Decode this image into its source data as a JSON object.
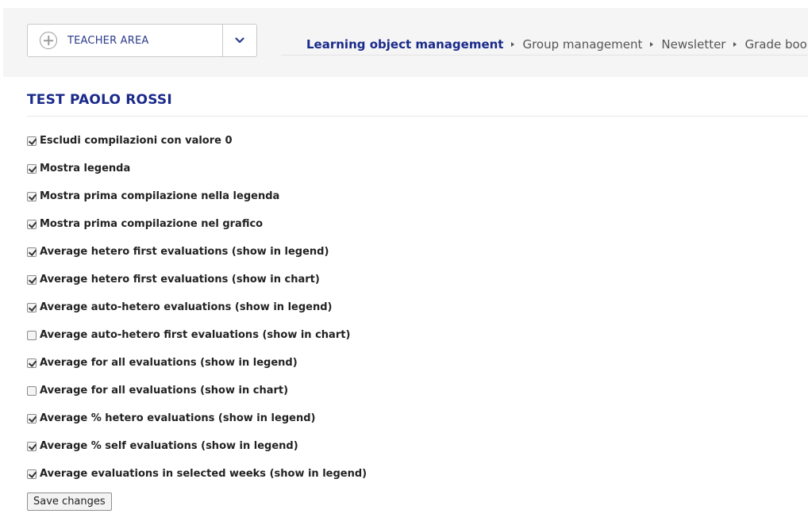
{
  "header": {
    "area_selector": {
      "label": "TEACHER AREA",
      "icon": "plus-circle-icon",
      "toggle_icon": "chevron-down-icon"
    },
    "nav": [
      {
        "label": "Learning object management",
        "active": true
      },
      {
        "label": "Group management",
        "active": false
      },
      {
        "label": "Newsletter",
        "active": false
      },
      {
        "label": "Grade book",
        "active": false
      }
    ]
  },
  "main": {
    "title": "TEST PAOLO ROSSI",
    "options": [
      {
        "label": "Escludi compilazioni con valore 0",
        "checked": true
      },
      {
        "label": "Mostra legenda",
        "checked": true
      },
      {
        "label": "Mostra prima compilazione nella legenda",
        "checked": true
      },
      {
        "label": "Mostra prima compilazione nel grafico",
        "checked": true
      },
      {
        "label": "Average hetero first evaluations (show in legend)",
        "checked": true
      },
      {
        "label": "Average hetero first evaluations (show in chart)",
        "checked": true
      },
      {
        "label": "Average auto-hetero evaluations (show in legend)",
        "checked": true
      },
      {
        "label": "Average auto-hetero first evaluations (show in chart)",
        "checked": false
      },
      {
        "label": "Average for all evaluations (show in legend)",
        "checked": true
      },
      {
        "label": "Average for all evaluations (show in chart)",
        "checked": false
      },
      {
        "label": "Average % hetero evaluations (show in legend)",
        "checked": true
      },
      {
        "label": "Average % self evaluations (show in legend)",
        "checked": true
      },
      {
        "label": "Average evaluations in selected weeks (show in legend)",
        "checked": true
      }
    ],
    "save_label": "Save changes"
  },
  "colors": {
    "accent": "#1a2a8a",
    "area_label": "#2b3a8c",
    "topbar_bg": "#f5f5f5"
  }
}
